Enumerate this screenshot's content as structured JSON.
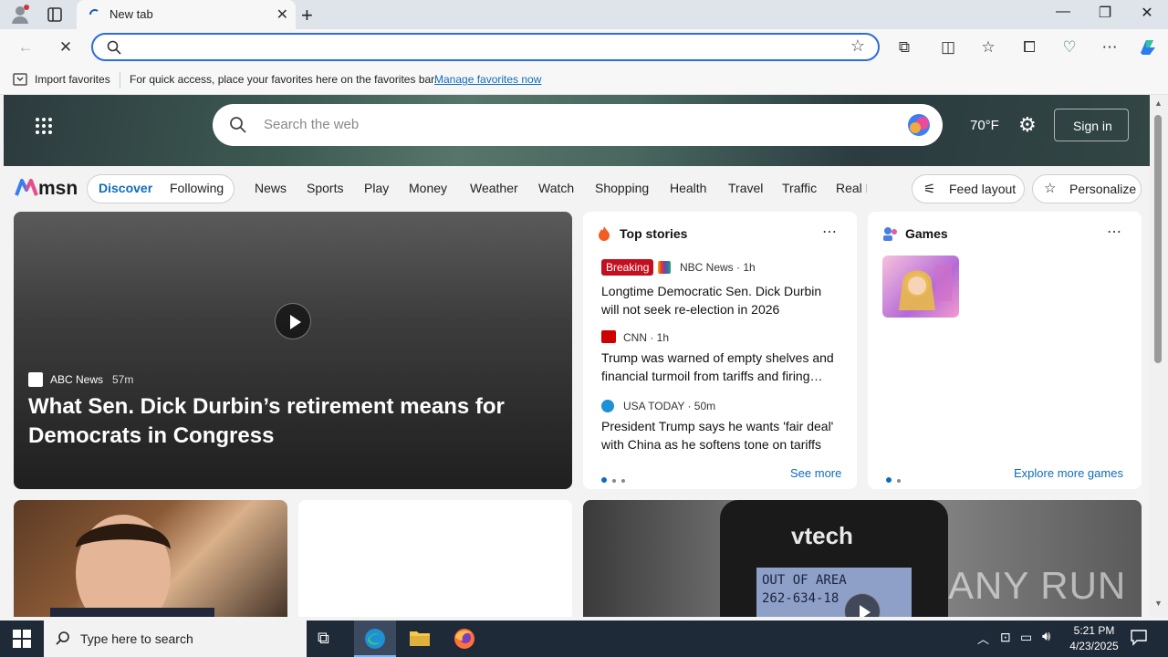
{
  "browser": {
    "tab_title": "New tab",
    "address_value": "",
    "favbar": {
      "import_label": "Import favorites",
      "message": "For quick access, place your favorites here on the favorites bar.",
      "manage_link": "Manage favorites now"
    }
  },
  "msn": {
    "search_placeholder": "Search the web",
    "weather": "70°F",
    "sign_in": "Sign in",
    "logo": "msn",
    "tabs": [
      "Discover",
      "Following"
    ],
    "nav": [
      "News",
      "Sports",
      "Play",
      "Money",
      "Weather",
      "Watch",
      "Shopping",
      "Health",
      "Travel",
      "Traffic",
      "Real E"
    ],
    "feed_layout": "Feed layout",
    "personalize": "Personalize",
    "hero": {
      "source": "ABC News",
      "time": "57m",
      "title": "What Sen. Dick Durbin’s retirement means for Democrats in Congress"
    },
    "top_stories": {
      "heading": "Top stories",
      "see_more": "See more",
      "items": [
        {
          "badge": "Breaking",
          "source": "NBC News · 1h",
          "title": "Longtime Democratic Sen. Dick Durbin will not seek re-election in 2026"
        },
        {
          "badge": "",
          "source": "CNN · 1h",
          "title": "Trump was warned of empty shelves and financial turmoil from tariffs and firing…"
        },
        {
          "badge": "",
          "source": "USA TODAY · 50m",
          "title": "President Trump says he wants 'fair deal' with China as he softens tone on tariffs"
        }
      ]
    },
    "games": {
      "heading": "Games",
      "explore": "Explore more games"
    },
    "video_card": {
      "brand_text": "vtech",
      "screen_text1": "OUT OF AREA",
      "screen_text2": "262-634-18",
      "watermark": "ANY RUN"
    }
  },
  "taskbar": {
    "search_placeholder": "Type here to search",
    "time": "5:21 PM",
    "date": "4/23/2025"
  },
  "colors": {
    "accent": "#0f6cbd",
    "breaking": "#c50f1f",
    "taskbar": "#1f2a38"
  }
}
